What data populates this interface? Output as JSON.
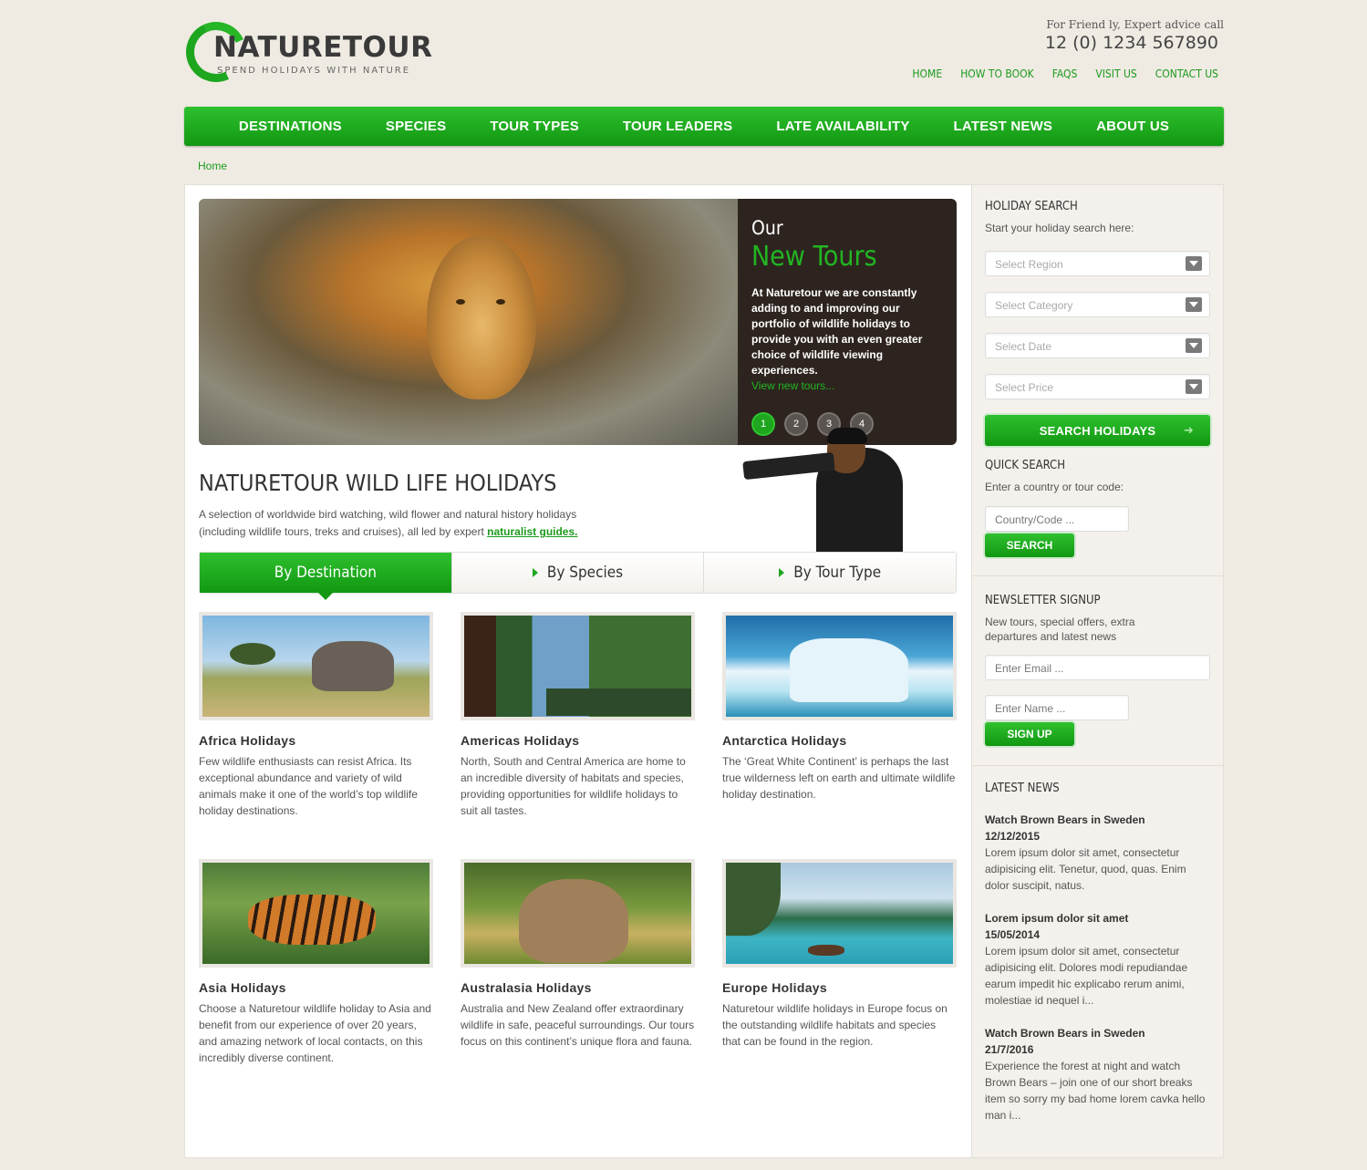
{
  "brand": {
    "name": "NATURETOUR",
    "tagline": "SPEND HOLIDAYS WITH NATURE"
  },
  "contact": {
    "advice": "For Friend   ly, Expert advice call",
    "phone": "12 (0) 1234 567890"
  },
  "top_links": [
    "HOME",
    "HOW TO BOOK",
    "FAQS",
    "VISIT US",
    "CONTACT US"
  ],
  "main_nav": [
    "DESTINATIONS",
    "SPECIES",
    "TOUR TYPES",
    "TOUR LEADERS",
    "LATE AVAILABILITY",
    "LATEST NEWS",
    "ABOUT US"
  ],
  "breadcrumb": "Home",
  "hero": {
    "line1": "Our",
    "line2": "New Tours",
    "text": "At Naturetour we are constantly adding to and improving our portfolio of wildlife holidays to provide you with an even greater choice of wildlife viewing experiences.",
    "link": "View new tours...",
    "pages": [
      "1",
      "2",
      "3",
      "4"
    ],
    "active_page": 0
  },
  "intro": {
    "title": "NATURETOUR WILD LIFE HOLIDAYS",
    "text": "A selection of worldwide bird watching, wild flower and natural history holidays (including wildlife tours, treks and cruises), all led by expert ",
    "link": "naturalist guides."
  },
  "tabs": [
    "By Destination",
    "By Species",
    "By Tour Type"
  ],
  "destinations": [
    {
      "title": "Africa Holidays",
      "text": "Few wildlife enthusiasts can resist Africa. Its exceptional abundance and variety of wild animals make it one of the world’s top wildlife holiday destinations."
    },
    {
      "title": "Americas Holidays",
      "text": "North, South and Central America are home to an incredible diversity of habitats and species, providing opportunities for wildlife holidays to suit all tastes."
    },
    {
      "title": "Antarctica Holidays",
      "text": "The ‘Great White Continent’ is perhaps the last true wilderness left on earth and ultimate wildlife holiday destination."
    },
    {
      "title": "Asia Holidays",
      "text": "Choose a Naturetour wildlife holiday to Asia and benefit from our experience of over 20 years, and amazing network of local contacts, on this incredibly diverse continent."
    },
    {
      "title": "Australasia Holidays",
      "text": "Australia and New Zealand offer extraordinary wildlife in safe, peaceful surroundings. Our tours focus on this continent’s unique flora and fauna."
    },
    {
      "title": "Europe Holidays",
      "text": "Naturetour wildlife holidays in Europe focus on the outstanding wildlife habitats and species that can be found in the region."
    }
  ],
  "holiday_search": {
    "title": "HOLIDAY SEARCH",
    "subtitle": "Start your holiday search here:",
    "selects": [
      "Select Region",
      "Select Category",
      "Select Date",
      "Select Price"
    ],
    "button": "SEARCH HOLIDAYS"
  },
  "quick_search": {
    "title": "QUICK SEARCH",
    "subtitle": "Enter a country or tour code:",
    "placeholder": "Country/Code ...",
    "button": "SEARCH"
  },
  "newsletter": {
    "title": "NEWSLETTER SIGNUP",
    "subtitle": "New tours, special offers, extra departures and latest news",
    "email_placeholder": "Enter Email ...",
    "name_placeholder": "Enter Name ...",
    "button": "SIGN UP"
  },
  "latest_news": {
    "title": "LATEST NEWS",
    "items": [
      {
        "title": "Watch Brown Bears in Sweden",
        "date": "12/12/2015",
        "text": "Lorem ipsum dolor sit amet, consectetur adipisicing elit. Tenetur, quod, quas. Enim dolor suscipit, natus."
      },
      {
        "title": "Lorem ipsum dolor sit amet",
        "date": "15/05/2014",
        "text": "Lorem ipsum dolor sit amet, consectetur adipisicing elit. Dolores modi repudiandae earum impedit hic explicabo rerum animi, molestiae id nequel i..."
      },
      {
        "title": "Watch Brown Bears in Sweden",
        "date": "21/7/2016",
        "text": "Experience the forest at night and watch Brown Bears – join one of our short breaks item so sorry my bad home lorem cavka hello man i..."
      }
    ]
  },
  "colors": {
    "accent": "#1ea61e",
    "background": "#efebe3",
    "hero_panel": "#2d241f"
  }
}
